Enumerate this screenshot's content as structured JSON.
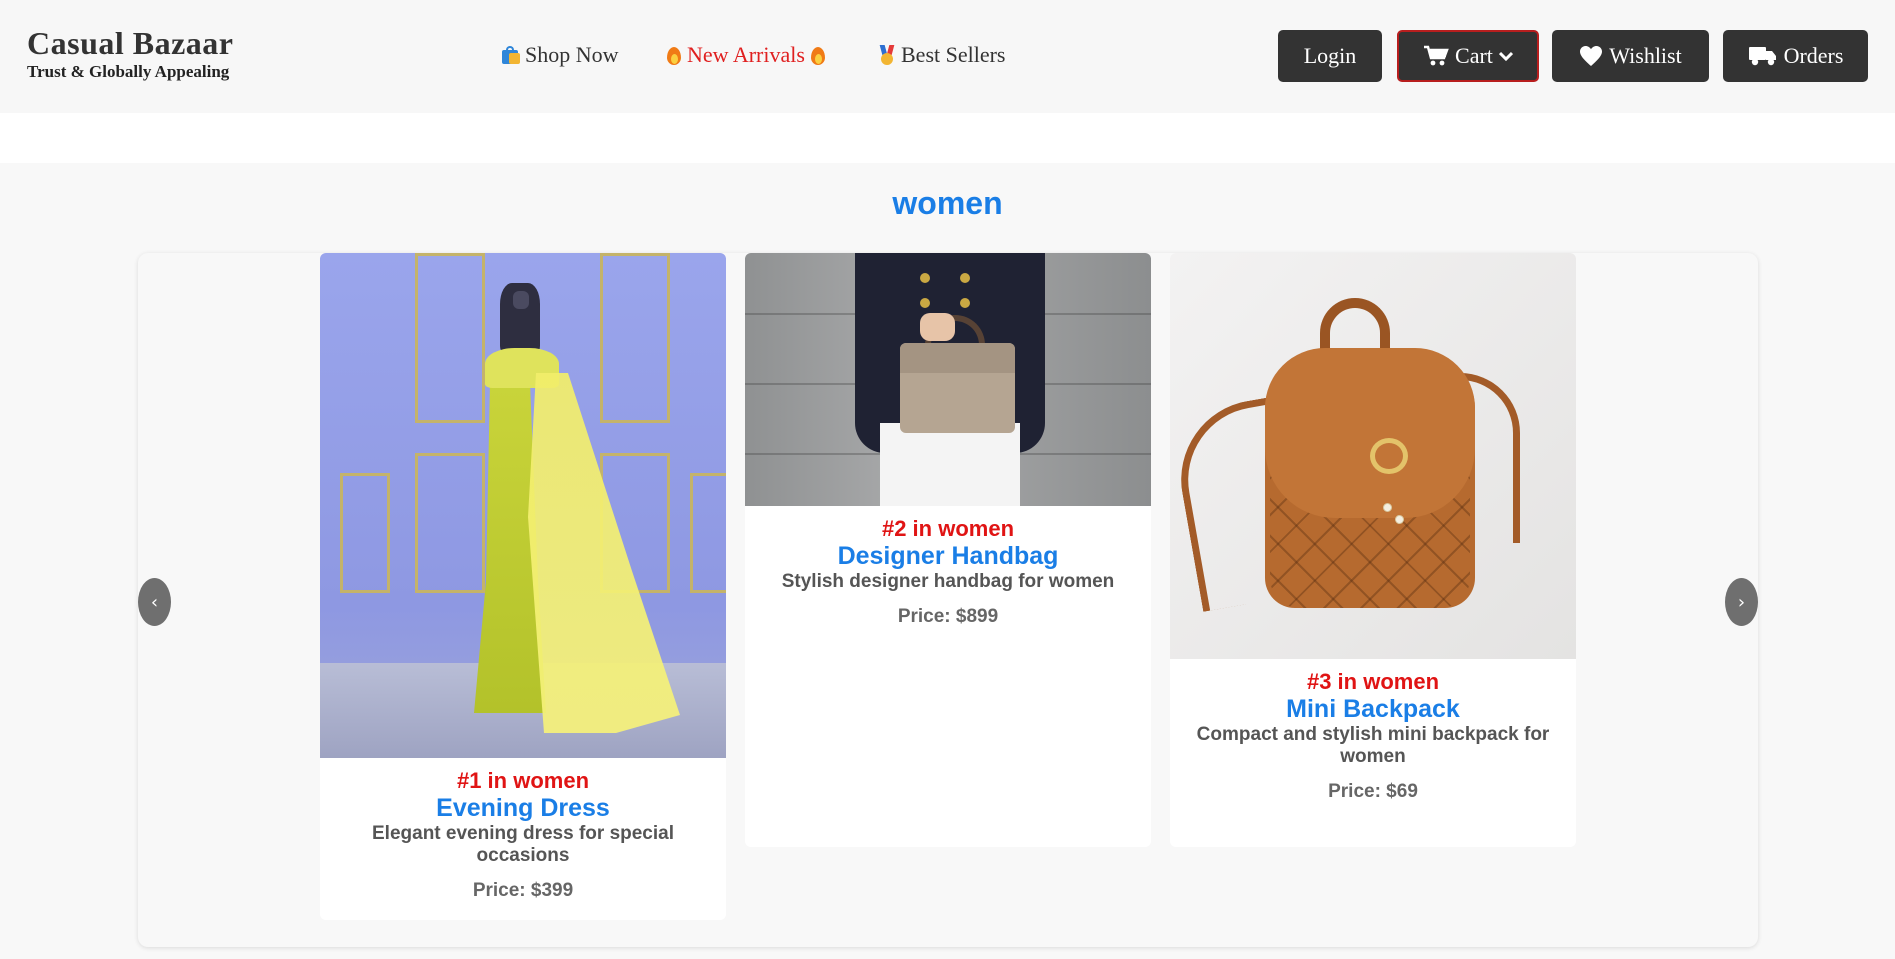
{
  "brand": {
    "name": "Casual Bazaar",
    "tagline": "Trust & Globally Appealing"
  },
  "nav": {
    "shop_now": "Shop Now",
    "new_arrivals": "New Arrivals",
    "best_sellers": "Best Sellers"
  },
  "actions": {
    "login": "Login",
    "cart": "Cart",
    "wishlist": "Wishlist",
    "orders": "Orders"
  },
  "colors": {
    "accent_blue": "#1a7ee6",
    "rank_red": "#e01414",
    "button_dark": "#333333",
    "hot_red": "#e02020"
  },
  "section": {
    "title": "women"
  },
  "carousel": {
    "prev": "‹",
    "next": "›",
    "items": [
      {
        "rank": "#1 in women",
        "name": "Evening Dress",
        "description": "Elegant evening dress for special occasions",
        "price": "Price: $399"
      },
      {
        "rank": "#2 in women",
        "name": "Designer Handbag",
        "description": "Stylish designer handbag for women",
        "price": "Price: $899"
      },
      {
        "rank": "#3 in women",
        "name": "Mini Backpack",
        "description": "Compact and stylish mini backpack for women",
        "price": "Price: $69"
      }
    ]
  }
}
